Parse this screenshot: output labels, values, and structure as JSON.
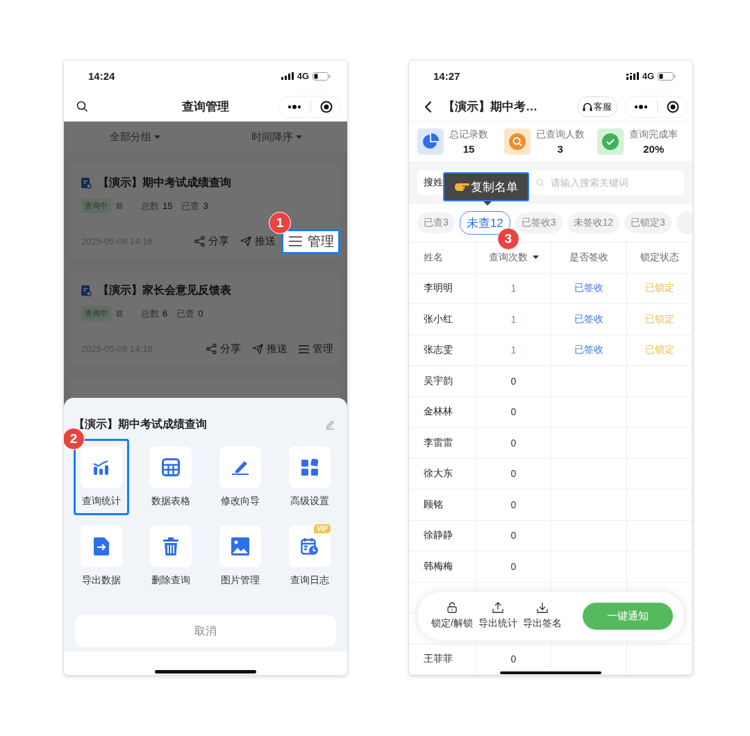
{
  "left_phone": {
    "status_bar": {
      "time": "14:24",
      "network": "4G"
    },
    "nav_bar": {
      "title": "查询管理"
    },
    "filters": [
      {
        "label": "全部分组"
      },
      {
        "label": "时间降序"
      }
    ],
    "cards": [
      {
        "title": "【演示】期中考试成绩查询",
        "status": "查询中",
        "total_label": "总数",
        "total": "15",
        "checked_label": "已查",
        "checked": "3",
        "date": "2025-05-08 14:16",
        "actions": [
          {
            "label": "分享",
            "kind": "share",
            "highlighted": false
          },
          {
            "label": "推送",
            "kind": "send",
            "highlighted": false
          },
          {
            "label": "管理",
            "kind": "manage",
            "highlighted": true,
            "callout": "1"
          }
        ]
      },
      {
        "title": "【演示】家长会意见反馈表",
        "status": "查询中",
        "total_label": "总数",
        "total": "6",
        "checked_label": "已查",
        "checked": "0",
        "date": "2025-05-08 14:16",
        "actions": [
          {
            "label": "分享",
            "kind": "share",
            "highlighted": false
          },
          {
            "label": "推送",
            "kind": "send",
            "highlighted": false
          },
          {
            "label": "管理",
            "kind": "manage",
            "highlighted": false
          }
        ]
      }
    ],
    "sheet": {
      "title": "【演示】期中考试成绩查询",
      "items": [
        {
          "label": "查询统计",
          "kind": "stats",
          "highlighted": true,
          "callout": "2"
        },
        {
          "label": "数据表格",
          "kind": "table",
          "highlighted": false
        },
        {
          "label": "修改向导",
          "kind": "edit",
          "highlighted": false
        },
        {
          "label": "高级设置",
          "kind": "tiles",
          "highlighted": false
        },
        {
          "label": "导出数据",
          "kind": "export",
          "highlighted": false
        },
        {
          "label": "删除查询",
          "kind": "delete",
          "highlighted": false
        },
        {
          "label": "图片管理",
          "kind": "image",
          "highlighted": false
        },
        {
          "label": "查询日志",
          "kind": "log",
          "highlighted": false,
          "badge": "VIP"
        }
      ],
      "cancel": "取消"
    }
  },
  "right_phone": {
    "status_bar": {
      "time": "14:27",
      "network": "4G"
    },
    "nav_bar": {
      "title": "【演示】期中考…",
      "service": "客服"
    },
    "stats": [
      {
        "label": "总记录数",
        "value": "15",
        "kind": "pie"
      },
      {
        "label": "已查询人数",
        "value": "3",
        "kind": "search"
      },
      {
        "label": "查询完成率",
        "value": "20%",
        "kind": "check"
      }
    ],
    "search": {
      "label": "搜姓",
      "placeholder": "请输入搜索关键词"
    },
    "tooltip": {
      "text": "复制名单"
    },
    "chips": [
      {
        "label": "已查3",
        "selected": false
      },
      {
        "label": "未查12",
        "selected": true,
        "callout": "3"
      },
      {
        "label": "已签收3",
        "selected": false
      },
      {
        "label": "未签收12",
        "selected": false
      },
      {
        "label": "已锁定3",
        "selected": false
      },
      {
        "selected": false
      }
    ],
    "table": {
      "columns": [
        {
          "label": "姓名"
        },
        {
          "label": "查询次数",
          "sortable": true
        },
        {
          "label": "是否签收"
        },
        {
          "label": "锁定状态"
        }
      ],
      "rows": [
        {
          "name": "李明明",
          "count": "1",
          "queried": true,
          "sign": "已签收",
          "lock": "已锁定"
        },
        {
          "name": "张小红",
          "count": "1",
          "queried": true,
          "sign": "已签收",
          "lock": "已锁定"
        },
        {
          "name": "张志雯",
          "count": "1",
          "queried": true,
          "sign": "已签收",
          "lock": "已锁定"
        },
        {
          "name": "吴宇韵",
          "count": "0",
          "queried": false
        },
        {
          "name": "金林林",
          "count": "0",
          "queried": false
        },
        {
          "name": "李雷雷",
          "count": "0",
          "queried": false
        },
        {
          "name": "徐大东",
          "count": "0",
          "queried": false
        },
        {
          "name": "顾铭",
          "count": "0",
          "queried": false
        },
        {
          "name": "徐静静",
          "count": "0",
          "queried": false
        },
        {
          "name": "韩梅梅",
          "count": "0",
          "queried": false
        },
        {},
        {},
        {
          "name": "王菲菲",
          "count": "0",
          "queried": false
        }
      ]
    },
    "toolbar": {
      "actions": [
        {
          "label": "锁定/解锁",
          "kind": "lock"
        },
        {
          "label": "导出统计",
          "kind": "upload"
        },
        {
          "label": "导出签名",
          "kind": "download"
        }
      ],
      "notify": "一键通知"
    }
  }
}
